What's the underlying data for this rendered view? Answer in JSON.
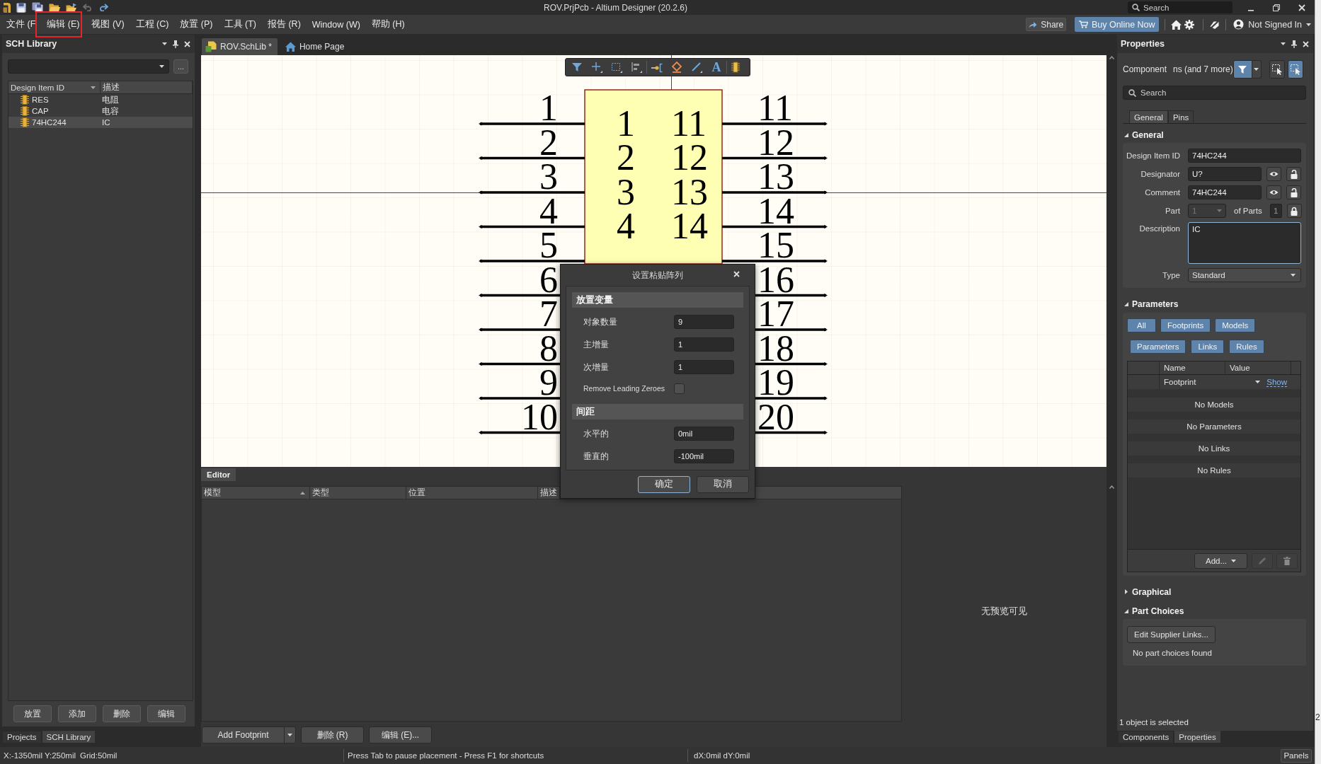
{
  "title_bar": {
    "title": "ROV.PrjPcb - Altium Designer (20.2.6)",
    "search": {
      "placeholder": "Search"
    }
  },
  "menu": [
    {
      "label": "文件 (F",
      "highlighted": false
    },
    {
      "label": "编辑 (E)",
      "highlighted": true
    },
    {
      "label": "视图 (V)",
      "highlighted": false
    },
    {
      "label": "工程 (C)",
      "highlighted": false
    },
    {
      "label": "放置 (P)",
      "highlighted": false
    },
    {
      "label": "工具 (T)",
      "highlighted": false
    },
    {
      "label": "报告 (R)",
      "highlighted": false
    },
    {
      "label": "Window (W)",
      "highlighted": false
    },
    {
      "label": "帮助 (H)",
      "highlighted": false
    }
  ],
  "header_actions": {
    "share": "Share",
    "buy": "Buy Online Now",
    "account": "Not Signed In"
  },
  "library_panel": {
    "title": "SCH Library",
    "browse_button": "...",
    "columns": [
      {
        "label": "Design Item ID",
        "sorted": true,
        "ascending": false
      },
      {
        "label": "描述",
        "sorted": false
      }
    ],
    "rows": [
      {
        "id": "RES",
        "description": "电阻",
        "selected": false
      },
      {
        "id": "CAP",
        "description": "电容",
        "selected": false
      },
      {
        "id": "74HC244",
        "description": "IC",
        "selected": true
      }
    ],
    "buttons": [
      "放置",
      "添加",
      "删除",
      "编辑"
    ],
    "tabs": [
      {
        "label": "Projects",
        "selected": false
      },
      {
        "label": "SCH Library",
        "selected": true
      }
    ]
  },
  "document_tabs": [
    {
      "label": "ROV.SchLib *",
      "kind": "library",
      "selected": true
    },
    {
      "label": "Home Page",
      "kind": "home",
      "selected": false
    }
  ],
  "canvas_toolbar": {
    "text_tool": "A"
  },
  "schematic": {
    "left_pins": [
      {
        "designator": "1",
        "name": "1"
      },
      {
        "designator": "2",
        "name": "2"
      },
      {
        "designator": "3",
        "name": "3"
      },
      {
        "designator": "4",
        "name": "4"
      },
      {
        "designator": "5"
      },
      {
        "designator": "6"
      },
      {
        "designator": "7"
      },
      {
        "designator": "8"
      },
      {
        "designator": "9"
      },
      {
        "designator": "10"
      }
    ],
    "right_pins": [
      {
        "designator": "11",
        "name": "11"
      },
      {
        "designator": "12",
        "name": "12"
      },
      {
        "designator": "13",
        "name": "13"
      },
      {
        "designator": "14",
        "name": "14"
      },
      {
        "designator": "15"
      },
      {
        "designator": "16"
      },
      {
        "designator": "17"
      },
      {
        "designator": "18"
      },
      {
        "designator": "19"
      },
      {
        "designator": "20"
      }
    ]
  },
  "editor": {
    "tab": "Editor",
    "columns": [
      {
        "label": "模型",
        "sorted": true,
        "ascending": true
      },
      {
        "label": "类型",
        "sorted": false
      },
      {
        "label": "位置",
        "sorted": false
      },
      {
        "label": "描述",
        "sorted": false
      }
    ],
    "preview": "无预览可见",
    "buttons": [
      {
        "label": "Add Footprint",
        "kind": "split"
      },
      {
        "label": "删除 (R)",
        "kind": "plain"
      },
      {
        "label": "编辑 (E)...",
        "kind": "plain"
      }
    ]
  },
  "dialog": {
    "title": "设置粘贴阵列",
    "sections": [
      {
        "heading": "放置变量",
        "rows": [
          {
            "kind": "field",
            "label": "对象数量",
            "value": "9"
          },
          {
            "kind": "field",
            "label": "主增量",
            "value": "1"
          },
          {
            "kind": "field",
            "label": "次增量",
            "value": "1"
          },
          {
            "kind": "checkbox",
            "label": "Remove Leading Zeroes",
            "checked": false
          }
        ]
      },
      {
        "heading": "间距",
        "rows": [
          {
            "kind": "field",
            "label": "水平的",
            "value": "0mil"
          },
          {
            "kind": "field",
            "label": "垂直的",
            "value": "-100mil"
          }
        ]
      }
    ],
    "buttons": [
      {
        "label": "确定",
        "default": true
      },
      {
        "label": "取消",
        "default": false
      }
    ]
  },
  "properties": {
    "title": "Properties",
    "filter_label": "Component",
    "filter_value": "ns (and 7 more)",
    "selection_modes": [
      {
        "selected": false
      },
      {
        "selected": true
      }
    ],
    "search": {
      "placeholder": "Search"
    },
    "tabs": [
      {
        "label": "General",
        "selected": true
      },
      {
        "label": "Pins",
        "selected": false
      }
    ],
    "general": {
      "title": "General",
      "expanded": true,
      "rows": [
        {
          "kind": "text",
          "label": "Design Item ID",
          "value": "74HC244"
        },
        {
          "kind": "visible_text",
          "label": "Designator",
          "value": "U?",
          "locked": false
        },
        {
          "kind": "visible_text",
          "label": "Comment",
          "value": "74HC244",
          "locked": false
        },
        {
          "kind": "part",
          "label": "Part",
          "value": "1",
          "disabled": true,
          "suffix": "of Parts",
          "count": "1",
          "locked": true
        },
        {
          "kind": "textarea",
          "label": "Description",
          "value": "IC"
        },
        {
          "kind": "select",
          "label": "Type",
          "value": "Standard"
        }
      ]
    },
    "parameters": {
      "title": "Parameters",
      "expanded": true,
      "filters": [
        "All",
        "Footprints",
        "Models",
        "Parameters",
        "Links",
        "Rules"
      ],
      "columns": [
        "Name",
        "Value"
      ],
      "rows": [
        {
          "name": "Footprint",
          "action": "Show"
        }
      ],
      "empty_messages": [
        "No Models",
        "No Parameters",
        "No Links",
        "No Rules"
      ],
      "add_button": "Add..."
    },
    "graphical": {
      "title": "Graphical",
      "expanded": false
    },
    "part_choices": {
      "title": "Part Choices",
      "expanded": true,
      "button": "Edit Supplier Links...",
      "message": "No part choices found"
    },
    "selection": "1 object is selected",
    "tabs_bottom": [
      {
        "label": "Components",
        "selected": false
      },
      {
        "label": "Properties",
        "selected": true
      }
    ]
  },
  "status_bar": {
    "position": "X:-1350mil Y:250mil",
    "grid": "Grid:50mil",
    "hint": "Press Tab to pause placement - Press F1 for shortcuts",
    "delta": "dX:0mil dY:0mil",
    "panels_button": "Panels"
  },
  "background_window": {
    "text": "2"
  }
}
